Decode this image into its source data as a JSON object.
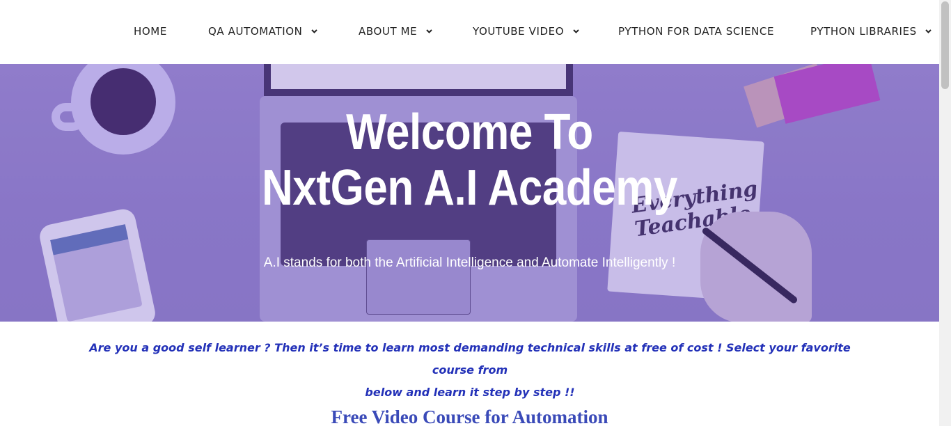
{
  "nav": {
    "items": [
      {
        "label": "HOME",
        "has_dropdown": false
      },
      {
        "label": "QA AUTOMATION",
        "has_dropdown": true
      },
      {
        "label": "ABOUT ME",
        "has_dropdown": true
      },
      {
        "label": "YOUTUBE VIDEO",
        "has_dropdown": true
      },
      {
        "label": "PYTHON FOR DATA SCIENCE",
        "has_dropdown": false
      },
      {
        "label": "PYTHON LIBRARIES",
        "has_dropdown": true
      }
    ],
    "caret_icon": "chevron-down-icon"
  },
  "hero": {
    "title_line1": "Welcome To",
    "title_line2": "NxtGen A.I Academy",
    "subtitle": "A.I stands for both the Artificial Intelligence and Automate Intelligently !",
    "notepad_text": "Everything Teachable",
    "overlay_color": "#8d7cc7"
  },
  "intro": {
    "line1": "Are you a good self learner ? Then it’s time to learn most demanding technical skills at free of cost ! Select your favorite course from",
    "line2": "below and learn it step by step !!"
  },
  "section": {
    "title": "Free Video Course for Automation"
  },
  "colors": {
    "intro_text": "#2331b8",
    "section_title": "#3a4ab8",
    "nav_text": "#222222"
  }
}
